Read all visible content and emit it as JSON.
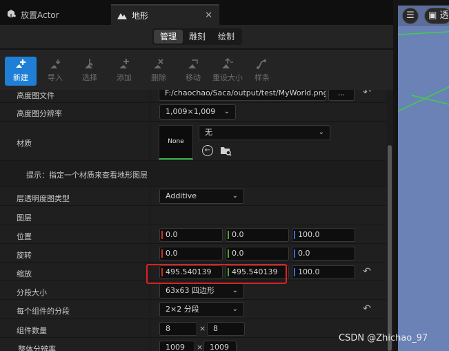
{
  "tabs": [
    {
      "label": "放置Actor",
      "icon": "place-actor-icon"
    },
    {
      "label": "地形",
      "icon": "landscape-icon"
    }
  ],
  "modes": [
    "管理",
    "雕刻",
    "绘制"
  ],
  "active_mode": "管理",
  "tools": [
    {
      "label": "新建",
      "icon": "new-plus-icon"
    },
    {
      "label": "导入",
      "icon": "import-icon"
    },
    {
      "label": "选择",
      "icon": "select-icon"
    },
    {
      "label": "添加",
      "icon": "add-icon"
    },
    {
      "label": "删除",
      "icon": "delete-icon"
    },
    {
      "label": "移动",
      "icon": "move-icon"
    },
    {
      "label": "重设大小",
      "icon": "resize-icon"
    },
    {
      "label": "样条",
      "icon": "spline-icon"
    }
  ],
  "heightmap": {
    "label": "高度图文件",
    "path": "F:/chaochao/Saca/output/test/MyWorld.png",
    "browse": "..."
  },
  "resolution": {
    "label": "高度图分辨率",
    "value": "1,009×1,009"
  },
  "material": {
    "label": "材质",
    "thumb": "None",
    "value": "无"
  },
  "hint": "提示：指定一个材质来查看地形图层",
  "layer_blend": {
    "label": "层透明度图类型",
    "value": "Additive"
  },
  "layers": {
    "label": "图层"
  },
  "location": {
    "label": "位置",
    "x": "0.0",
    "y": "0.0",
    "z": "100.0"
  },
  "rotation": {
    "label": "旋转",
    "x": "0.0",
    "y": "0.0",
    "z": "0.0"
  },
  "scale": {
    "label": "缩放",
    "x": "495.540139",
    "y": "495.540139",
    "z": "100.0"
  },
  "section_size": {
    "label": "分段大小",
    "value": "63x63 四边形"
  },
  "sections_per_component": {
    "label": "每个组件的分段",
    "value": "2×2 分段"
  },
  "component_count": {
    "label": "组件数量",
    "x": "8",
    "sep": "×",
    "y": "8"
  },
  "overall_resolution": {
    "label": "整体分辨率",
    "x": "1009",
    "sep": "×",
    "y": "1009"
  },
  "viewport": {
    "menu_icon": "hamburger-menu-icon",
    "view_label": "透"
  },
  "watermark": "CSDN @Zhichao_97",
  "colors": {
    "accent": "#1f7fd6",
    "x_axis": "#c8321e",
    "y_axis": "#58a530",
    "z_axis": "#2d6fd6",
    "highlight": "#e02020"
  }
}
